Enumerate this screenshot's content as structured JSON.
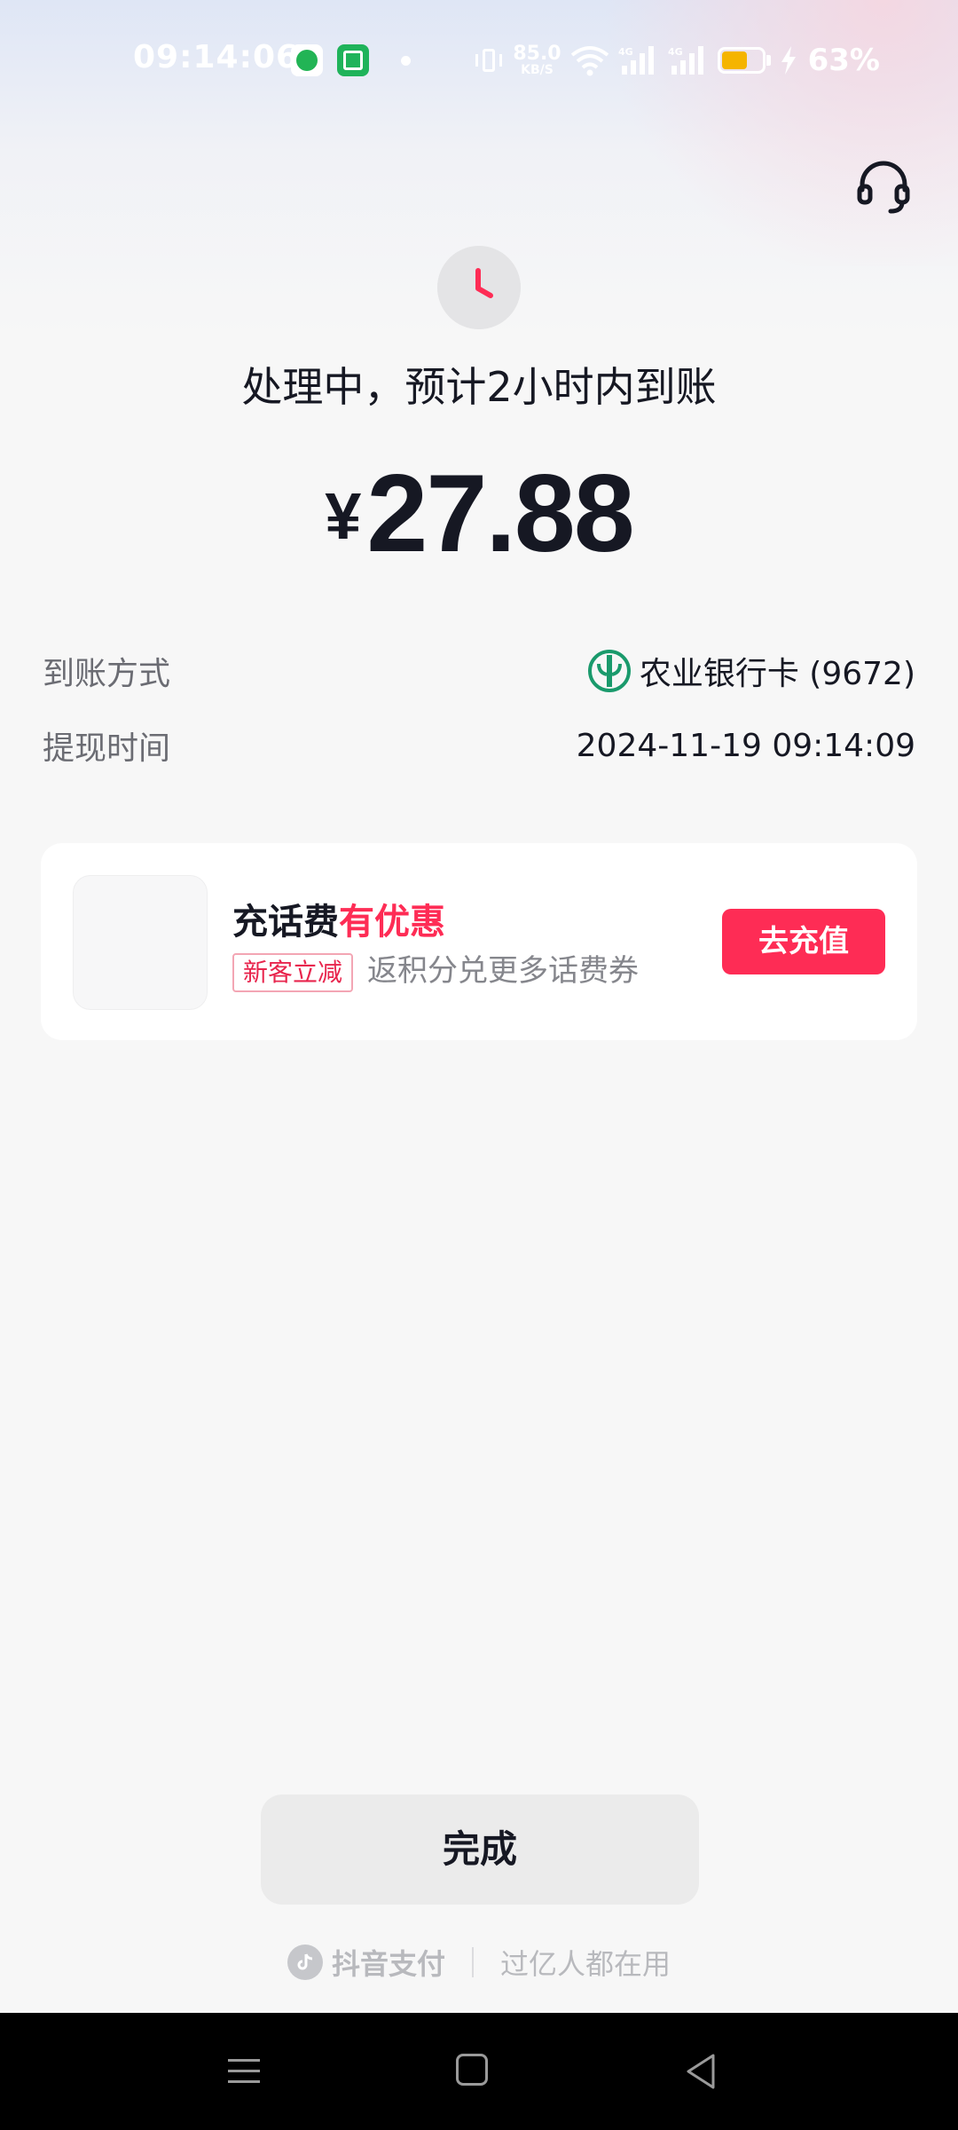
{
  "status_bar": {
    "time": "09:14:06",
    "net_speed_value": "85.0",
    "net_speed_unit": "KB/S",
    "battery_level": 0.63,
    "battery_percent": "63%",
    "network_label_1": "4G",
    "network_label_2": "4G"
  },
  "header": {
    "support_icon": "headset-icon"
  },
  "status": {
    "icon": "clock-icon",
    "text": "处理中，预计2小时内到账"
  },
  "amount": {
    "currency": "¥",
    "value": "27.88"
  },
  "details": {
    "method_label": "到账方式",
    "method_value": "农业银行卡 (9672)",
    "time_label": "提现时间",
    "time_value": "2024-11-19 09:14:09"
  },
  "promo": {
    "title_prefix": "充话费",
    "title_highlight": "有优惠",
    "tag": "新客立减",
    "description": "返积分兑更多话费券",
    "button": "去充值"
  },
  "done_button": "完成",
  "footer": {
    "brand": "抖音支付",
    "slogan": "过亿人都在用"
  },
  "colors": {
    "accent": "#fe2c55",
    "text_primary": "#161823",
    "text_secondary": "#6b6c73",
    "bank_green": "#1a9a6c"
  }
}
